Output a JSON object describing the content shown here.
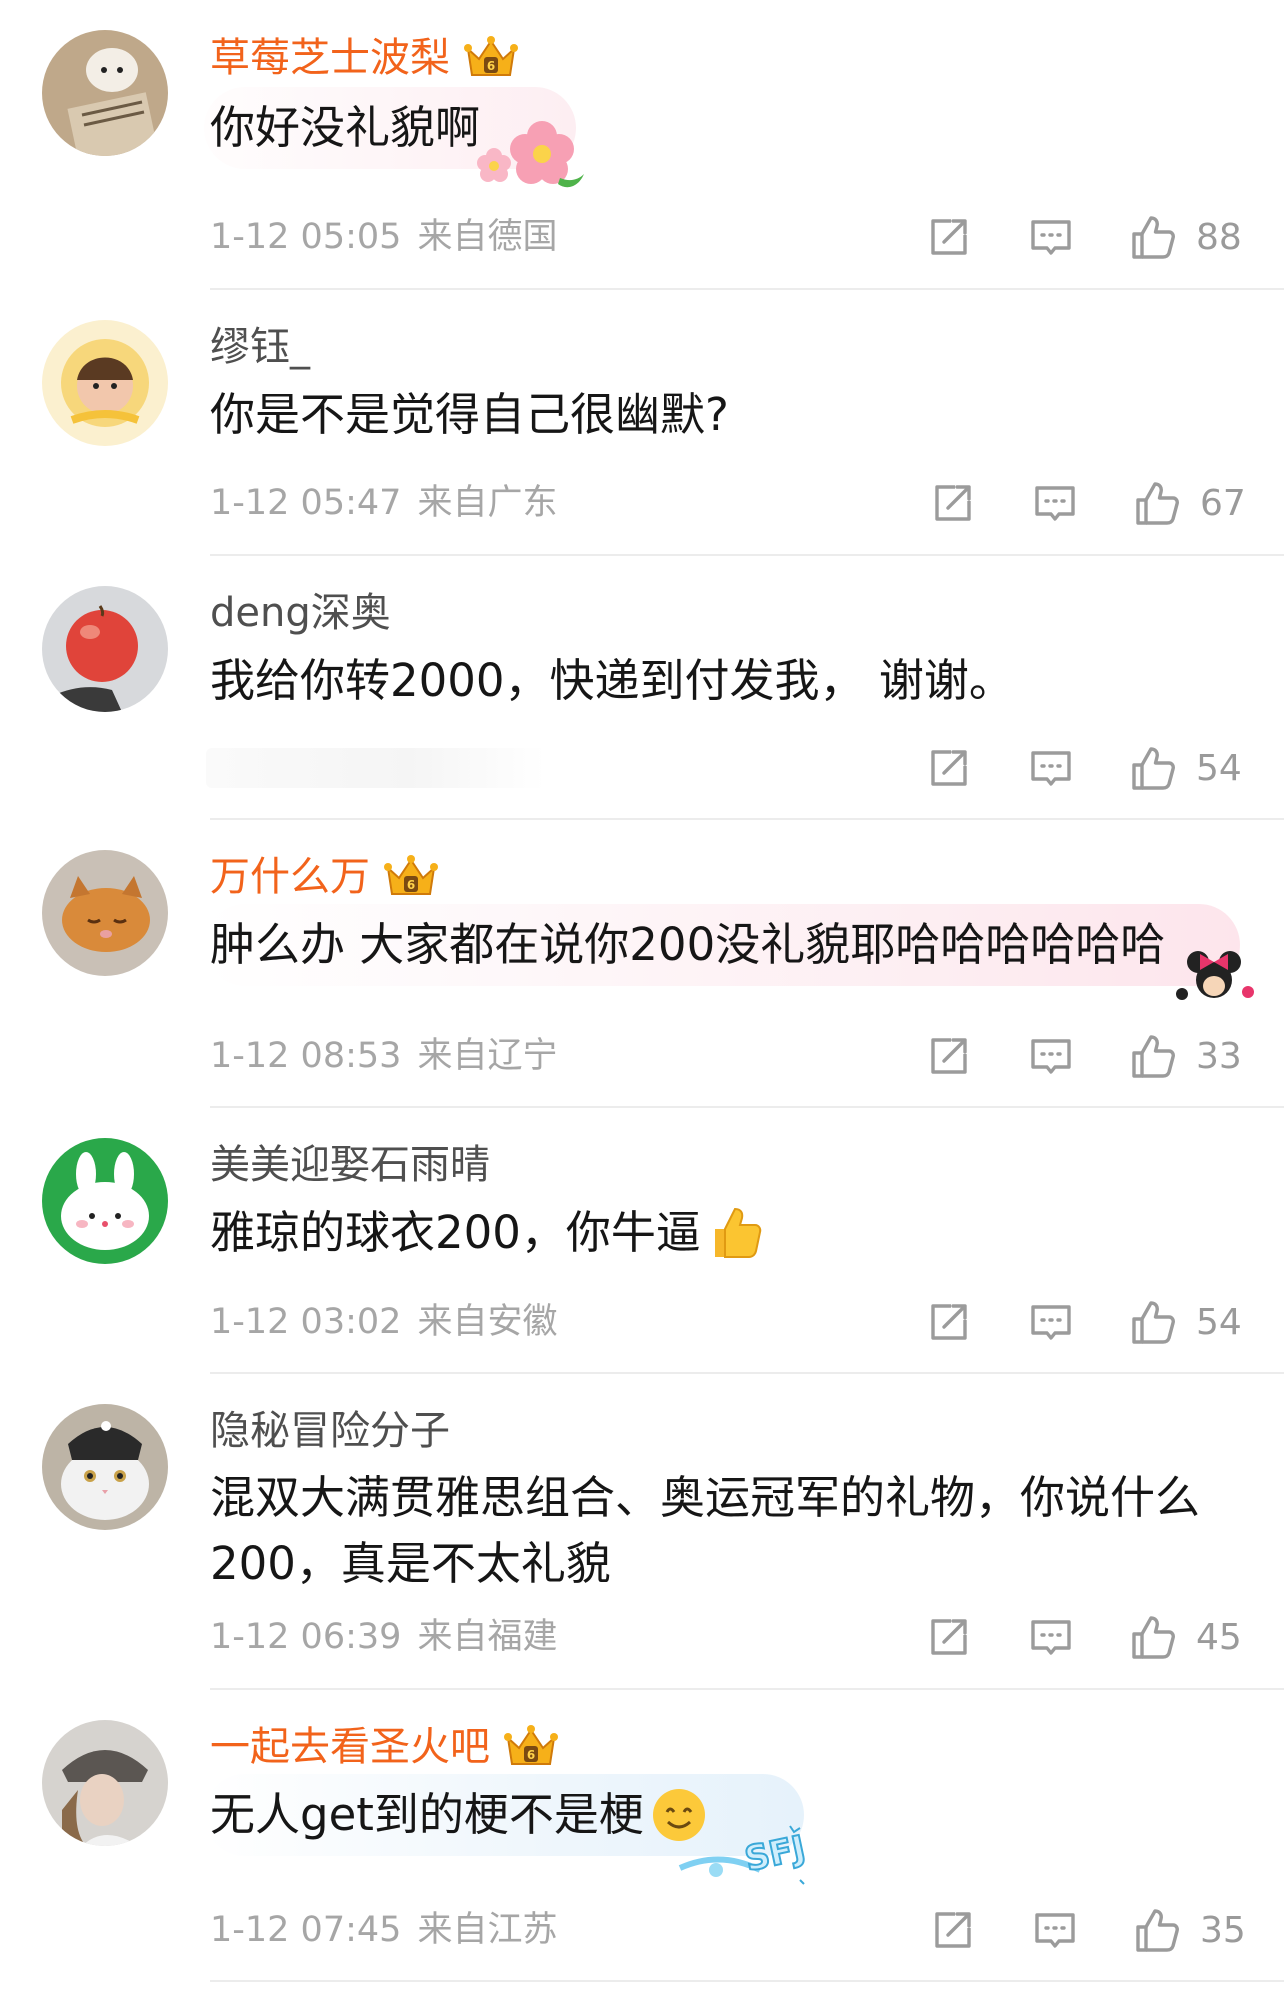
{
  "comments": [
    {
      "username": "草莓芝士波梨",
      "vip": true,
      "text": "你好没礼貌啊",
      "date": "1-12 05:05",
      "location": "来自德国",
      "likes": "88"
    },
    {
      "username": "缪钰_",
      "vip": false,
      "text": "你是不是觉得自己很幽默?",
      "date": "1-12 05:47",
      "location": "来自广东",
      "likes": "67"
    },
    {
      "username": "deng深奥",
      "vip": false,
      "text": "我给你转2000，快递到付发我， 谢谢。",
      "date": "",
      "location": "",
      "likes": "54"
    },
    {
      "username": "万什么万",
      "vip": true,
      "text": "肿么办 大家都在说你200没礼貌耶哈哈哈哈哈哈",
      "date": "1-12 08:53",
      "location": "来自辽宁",
      "likes": "33"
    },
    {
      "username": "美美迎娶石雨晴",
      "vip": false,
      "text": "雅琼的球衣200，你牛逼",
      "date": "1-12 03:02",
      "location": "来自安徽",
      "likes": "54"
    },
    {
      "username": "隐秘冒险分子",
      "vip": false,
      "text_line1": "混双大满贯雅思组合、奥运冠军的礼物，你说什么",
      "text_line2": "200，真是不太礼貌",
      "date": "1-12 06:39",
      "location": "来自福建",
      "likes": "45"
    },
    {
      "username": "一起去看圣火吧",
      "vip": true,
      "text": "无人get到的梗不是梗",
      "date": "1-12 07:45",
      "location": "来自江苏",
      "likes": "35"
    }
  ],
  "stickers": {
    "sfj_text": "SFJ"
  },
  "icons": {
    "share": "share-icon",
    "comment": "comment-icon",
    "like": "thumbs-up-icon",
    "badge": "vip-crown-icon"
  },
  "colors": {
    "vip_name": "#f2631b",
    "name": "#4f4f4f",
    "text": "#161616",
    "meta": "#a6a6a6",
    "divider": "#ececec"
  }
}
